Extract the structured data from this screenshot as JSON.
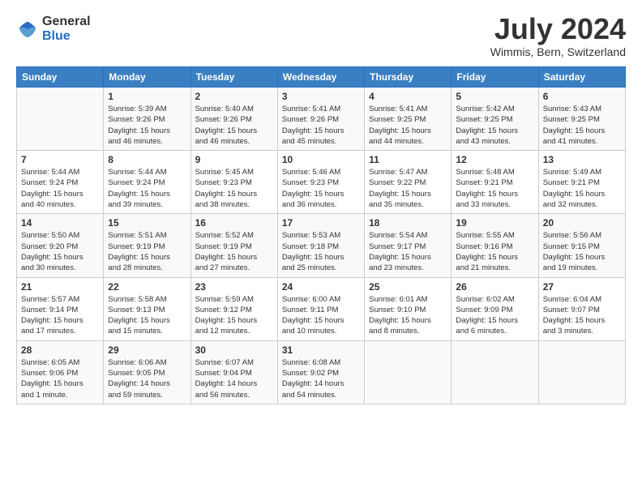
{
  "header": {
    "logo_general": "General",
    "logo_blue": "Blue",
    "month_year": "July 2024",
    "location": "Wimmis, Bern, Switzerland"
  },
  "calendar": {
    "days_of_week": [
      "Sunday",
      "Monday",
      "Tuesday",
      "Wednesday",
      "Thursday",
      "Friday",
      "Saturday"
    ],
    "weeks": [
      [
        {
          "day": "",
          "info": ""
        },
        {
          "day": "1",
          "info": "Sunrise: 5:39 AM\nSunset: 9:26 PM\nDaylight: 15 hours\nand 46 minutes."
        },
        {
          "day": "2",
          "info": "Sunrise: 5:40 AM\nSunset: 9:26 PM\nDaylight: 15 hours\nand 46 minutes."
        },
        {
          "day": "3",
          "info": "Sunrise: 5:41 AM\nSunset: 9:26 PM\nDaylight: 15 hours\nand 45 minutes."
        },
        {
          "day": "4",
          "info": "Sunrise: 5:41 AM\nSunset: 9:25 PM\nDaylight: 15 hours\nand 44 minutes."
        },
        {
          "day": "5",
          "info": "Sunrise: 5:42 AM\nSunset: 9:25 PM\nDaylight: 15 hours\nand 43 minutes."
        },
        {
          "day": "6",
          "info": "Sunrise: 5:43 AM\nSunset: 9:25 PM\nDaylight: 15 hours\nand 41 minutes."
        }
      ],
      [
        {
          "day": "7",
          "info": "Sunrise: 5:44 AM\nSunset: 9:24 PM\nDaylight: 15 hours\nand 40 minutes."
        },
        {
          "day": "8",
          "info": "Sunrise: 5:44 AM\nSunset: 9:24 PM\nDaylight: 15 hours\nand 39 minutes."
        },
        {
          "day": "9",
          "info": "Sunrise: 5:45 AM\nSunset: 9:23 PM\nDaylight: 15 hours\nand 38 minutes."
        },
        {
          "day": "10",
          "info": "Sunrise: 5:46 AM\nSunset: 9:23 PM\nDaylight: 15 hours\nand 36 minutes."
        },
        {
          "day": "11",
          "info": "Sunrise: 5:47 AM\nSunset: 9:22 PM\nDaylight: 15 hours\nand 35 minutes."
        },
        {
          "day": "12",
          "info": "Sunrise: 5:48 AM\nSunset: 9:21 PM\nDaylight: 15 hours\nand 33 minutes."
        },
        {
          "day": "13",
          "info": "Sunrise: 5:49 AM\nSunset: 9:21 PM\nDaylight: 15 hours\nand 32 minutes."
        }
      ],
      [
        {
          "day": "14",
          "info": "Sunrise: 5:50 AM\nSunset: 9:20 PM\nDaylight: 15 hours\nand 30 minutes."
        },
        {
          "day": "15",
          "info": "Sunrise: 5:51 AM\nSunset: 9:19 PM\nDaylight: 15 hours\nand 28 minutes."
        },
        {
          "day": "16",
          "info": "Sunrise: 5:52 AM\nSunset: 9:19 PM\nDaylight: 15 hours\nand 27 minutes."
        },
        {
          "day": "17",
          "info": "Sunrise: 5:53 AM\nSunset: 9:18 PM\nDaylight: 15 hours\nand 25 minutes."
        },
        {
          "day": "18",
          "info": "Sunrise: 5:54 AM\nSunset: 9:17 PM\nDaylight: 15 hours\nand 23 minutes."
        },
        {
          "day": "19",
          "info": "Sunrise: 5:55 AM\nSunset: 9:16 PM\nDaylight: 15 hours\nand 21 minutes."
        },
        {
          "day": "20",
          "info": "Sunrise: 5:56 AM\nSunset: 9:15 PM\nDaylight: 15 hours\nand 19 minutes."
        }
      ],
      [
        {
          "day": "21",
          "info": "Sunrise: 5:57 AM\nSunset: 9:14 PM\nDaylight: 15 hours\nand 17 minutes."
        },
        {
          "day": "22",
          "info": "Sunrise: 5:58 AM\nSunset: 9:13 PM\nDaylight: 15 hours\nand 15 minutes."
        },
        {
          "day": "23",
          "info": "Sunrise: 5:59 AM\nSunset: 9:12 PM\nDaylight: 15 hours\nand 12 minutes."
        },
        {
          "day": "24",
          "info": "Sunrise: 6:00 AM\nSunset: 9:11 PM\nDaylight: 15 hours\nand 10 minutes."
        },
        {
          "day": "25",
          "info": "Sunrise: 6:01 AM\nSunset: 9:10 PM\nDaylight: 15 hours\nand 8 minutes."
        },
        {
          "day": "26",
          "info": "Sunrise: 6:02 AM\nSunset: 9:09 PM\nDaylight: 15 hours\nand 6 minutes."
        },
        {
          "day": "27",
          "info": "Sunrise: 6:04 AM\nSunset: 9:07 PM\nDaylight: 15 hours\nand 3 minutes."
        }
      ],
      [
        {
          "day": "28",
          "info": "Sunrise: 6:05 AM\nSunset: 9:06 PM\nDaylight: 15 hours\nand 1 minute."
        },
        {
          "day": "29",
          "info": "Sunrise: 6:06 AM\nSunset: 9:05 PM\nDaylight: 14 hours\nand 59 minutes."
        },
        {
          "day": "30",
          "info": "Sunrise: 6:07 AM\nSunset: 9:04 PM\nDaylight: 14 hours\nand 56 minutes."
        },
        {
          "day": "31",
          "info": "Sunrise: 6:08 AM\nSunset: 9:02 PM\nDaylight: 14 hours\nand 54 minutes."
        },
        {
          "day": "",
          "info": ""
        },
        {
          "day": "",
          "info": ""
        },
        {
          "day": "",
          "info": ""
        }
      ]
    ]
  }
}
